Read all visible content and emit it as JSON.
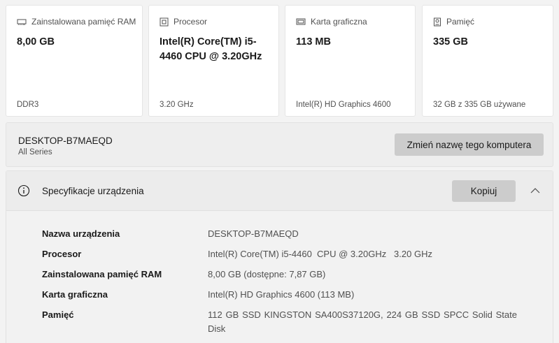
{
  "cards": [
    {
      "id": "ram",
      "title": "Zainstalowana pamięć RAM",
      "icon": "ram-icon",
      "value": "8,00 GB",
      "sub": "DDR3"
    },
    {
      "id": "cpu",
      "title": "Procesor",
      "icon": "processor-icon",
      "value": "Intel(R) Core(TM) i5-4460 CPU @ 3.20GHz",
      "sub": "3.20 GHz"
    },
    {
      "id": "gpu",
      "title": "Karta graficzna",
      "icon": "graphics-card-icon",
      "value": "113 MB",
      "sub": "Intel(R) HD Graphics 4600"
    },
    {
      "id": "storage",
      "title": "Pamięć",
      "icon": "storage-icon",
      "value": "335 GB",
      "sub": "32 GB z 335 GB używane"
    }
  ],
  "pc": {
    "name": "DESKTOP-B7MAEQD",
    "model": "All Series",
    "rename_label": "Zmień nazwę tego komputera"
  },
  "spec": {
    "title": "Specyfikacje urządzenia",
    "copy_label": "Kopiuj",
    "rows": [
      {
        "label": "Nazwa urządzenia",
        "value": "DESKTOP-B7MAEQD"
      },
      {
        "label": "Procesor",
        "value": "Intel(R) Core(TM) i5-4460  CPU @ 3.20GHz   3.20 GHz"
      },
      {
        "label": "Zainstalowana pamięć RAM",
        "value": "8,00 GB (dostępne: 7,87 GB)"
      },
      {
        "label": "Karta graficzna",
        "value": "Intel(R) HD Graphics 4600 (113 MB)"
      },
      {
        "label": "Pamięć",
        "value": "112 GB SSD KINGSTON SA400S37120G, 224 GB SSD SPCC Solid State Disk"
      }
    ]
  }
}
